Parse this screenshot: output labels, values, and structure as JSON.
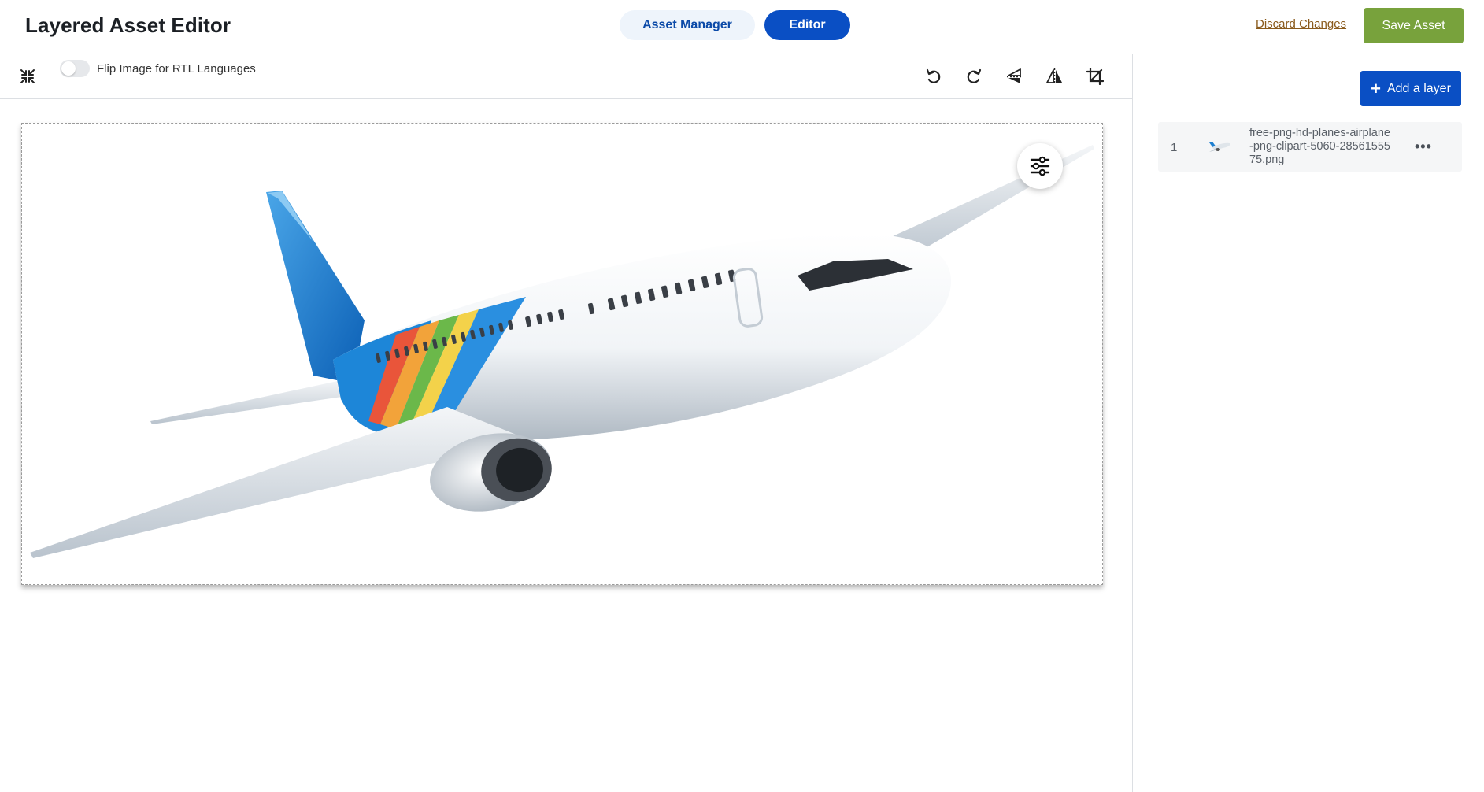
{
  "header": {
    "title": "Layered Asset Editor",
    "tabs": [
      {
        "label": "Asset Manager",
        "active": false
      },
      {
        "label": "Editor",
        "active": true
      }
    ],
    "discard_label": "Discard Changes",
    "save_label": "Save Asset"
  },
  "toolbar": {
    "fit_icon": "collapse-arrows-icon",
    "flip_toggle": {
      "label": "Flip Image for RTL Languages",
      "checked": false
    },
    "actions": [
      "undo-icon",
      "redo-icon",
      "flip-vertical-icon",
      "flip-horizontal-icon",
      "crop-icon"
    ]
  },
  "canvas": {
    "image_subject": "airplane",
    "adjust_icon": "sliders-icon"
  },
  "layers_panel": {
    "add_label": "Add a layer",
    "layers": [
      {
        "index": "1",
        "name": "free-png-hd-planes-airplane-png-clipart-5060-2856155575.png",
        "menu": "•••"
      }
    ]
  },
  "colors": {
    "primary": "#0a4fc4",
    "save": "#78a23c",
    "discard": "#8a5a1c"
  }
}
